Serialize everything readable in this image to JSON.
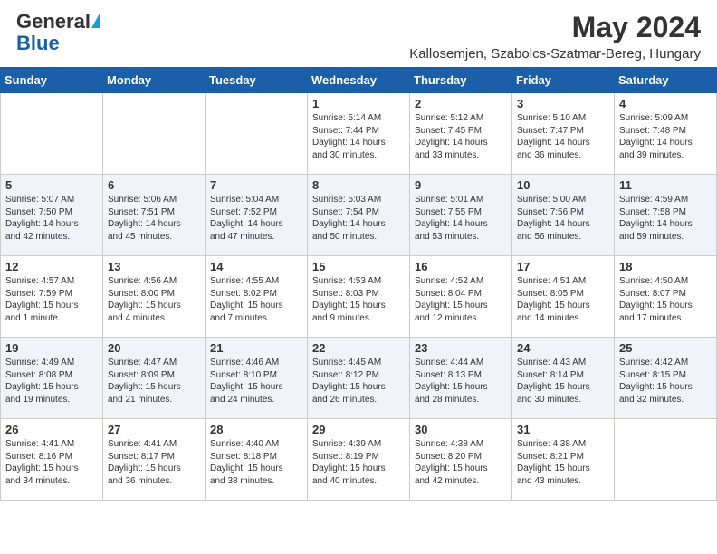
{
  "header": {
    "logo_general": "General",
    "logo_blue": "Blue",
    "month_title": "May 2024",
    "location": "Kallosemjen, Szabolcs-Szatmar-Bereg, Hungary"
  },
  "days_of_week": [
    "Sunday",
    "Monday",
    "Tuesday",
    "Wednesday",
    "Thursday",
    "Friday",
    "Saturday"
  ],
  "weeks": [
    [
      {
        "day": "",
        "lines": []
      },
      {
        "day": "",
        "lines": []
      },
      {
        "day": "",
        "lines": []
      },
      {
        "day": "1",
        "lines": [
          "Sunrise: 5:14 AM",
          "Sunset: 7:44 PM",
          "Daylight: 14 hours",
          "and 30 minutes."
        ]
      },
      {
        "day": "2",
        "lines": [
          "Sunrise: 5:12 AM",
          "Sunset: 7:45 PM",
          "Daylight: 14 hours",
          "and 33 minutes."
        ]
      },
      {
        "day": "3",
        "lines": [
          "Sunrise: 5:10 AM",
          "Sunset: 7:47 PM",
          "Daylight: 14 hours",
          "and 36 minutes."
        ]
      },
      {
        "day": "4",
        "lines": [
          "Sunrise: 5:09 AM",
          "Sunset: 7:48 PM",
          "Daylight: 14 hours",
          "and 39 minutes."
        ]
      }
    ],
    [
      {
        "day": "5",
        "lines": [
          "Sunrise: 5:07 AM",
          "Sunset: 7:50 PM",
          "Daylight: 14 hours",
          "and 42 minutes."
        ]
      },
      {
        "day": "6",
        "lines": [
          "Sunrise: 5:06 AM",
          "Sunset: 7:51 PM",
          "Daylight: 14 hours",
          "and 45 minutes."
        ]
      },
      {
        "day": "7",
        "lines": [
          "Sunrise: 5:04 AM",
          "Sunset: 7:52 PM",
          "Daylight: 14 hours",
          "and 47 minutes."
        ]
      },
      {
        "day": "8",
        "lines": [
          "Sunrise: 5:03 AM",
          "Sunset: 7:54 PM",
          "Daylight: 14 hours",
          "and 50 minutes."
        ]
      },
      {
        "day": "9",
        "lines": [
          "Sunrise: 5:01 AM",
          "Sunset: 7:55 PM",
          "Daylight: 14 hours",
          "and 53 minutes."
        ]
      },
      {
        "day": "10",
        "lines": [
          "Sunrise: 5:00 AM",
          "Sunset: 7:56 PM",
          "Daylight: 14 hours",
          "and 56 minutes."
        ]
      },
      {
        "day": "11",
        "lines": [
          "Sunrise: 4:59 AM",
          "Sunset: 7:58 PM",
          "Daylight: 14 hours",
          "and 59 minutes."
        ]
      }
    ],
    [
      {
        "day": "12",
        "lines": [
          "Sunrise: 4:57 AM",
          "Sunset: 7:59 PM",
          "Daylight: 15 hours",
          "and 1 minute."
        ]
      },
      {
        "day": "13",
        "lines": [
          "Sunrise: 4:56 AM",
          "Sunset: 8:00 PM",
          "Daylight: 15 hours",
          "and 4 minutes."
        ]
      },
      {
        "day": "14",
        "lines": [
          "Sunrise: 4:55 AM",
          "Sunset: 8:02 PM",
          "Daylight: 15 hours",
          "and 7 minutes."
        ]
      },
      {
        "day": "15",
        "lines": [
          "Sunrise: 4:53 AM",
          "Sunset: 8:03 PM",
          "Daylight: 15 hours",
          "and 9 minutes."
        ]
      },
      {
        "day": "16",
        "lines": [
          "Sunrise: 4:52 AM",
          "Sunset: 8:04 PM",
          "Daylight: 15 hours",
          "and 12 minutes."
        ]
      },
      {
        "day": "17",
        "lines": [
          "Sunrise: 4:51 AM",
          "Sunset: 8:05 PM",
          "Daylight: 15 hours",
          "and 14 minutes."
        ]
      },
      {
        "day": "18",
        "lines": [
          "Sunrise: 4:50 AM",
          "Sunset: 8:07 PM",
          "Daylight: 15 hours",
          "and 17 minutes."
        ]
      }
    ],
    [
      {
        "day": "19",
        "lines": [
          "Sunrise: 4:49 AM",
          "Sunset: 8:08 PM",
          "Daylight: 15 hours",
          "and 19 minutes."
        ]
      },
      {
        "day": "20",
        "lines": [
          "Sunrise: 4:47 AM",
          "Sunset: 8:09 PM",
          "Daylight: 15 hours",
          "and 21 minutes."
        ]
      },
      {
        "day": "21",
        "lines": [
          "Sunrise: 4:46 AM",
          "Sunset: 8:10 PM",
          "Daylight: 15 hours",
          "and 24 minutes."
        ]
      },
      {
        "day": "22",
        "lines": [
          "Sunrise: 4:45 AM",
          "Sunset: 8:12 PM",
          "Daylight: 15 hours",
          "and 26 minutes."
        ]
      },
      {
        "day": "23",
        "lines": [
          "Sunrise: 4:44 AM",
          "Sunset: 8:13 PM",
          "Daylight: 15 hours",
          "and 28 minutes."
        ]
      },
      {
        "day": "24",
        "lines": [
          "Sunrise: 4:43 AM",
          "Sunset: 8:14 PM",
          "Daylight: 15 hours",
          "and 30 minutes."
        ]
      },
      {
        "day": "25",
        "lines": [
          "Sunrise: 4:42 AM",
          "Sunset: 8:15 PM",
          "Daylight: 15 hours",
          "and 32 minutes."
        ]
      }
    ],
    [
      {
        "day": "26",
        "lines": [
          "Sunrise: 4:41 AM",
          "Sunset: 8:16 PM",
          "Daylight: 15 hours",
          "and 34 minutes."
        ]
      },
      {
        "day": "27",
        "lines": [
          "Sunrise: 4:41 AM",
          "Sunset: 8:17 PM",
          "Daylight: 15 hours",
          "and 36 minutes."
        ]
      },
      {
        "day": "28",
        "lines": [
          "Sunrise: 4:40 AM",
          "Sunset: 8:18 PM",
          "Daylight: 15 hours",
          "and 38 minutes."
        ]
      },
      {
        "day": "29",
        "lines": [
          "Sunrise: 4:39 AM",
          "Sunset: 8:19 PM",
          "Daylight: 15 hours",
          "and 40 minutes."
        ]
      },
      {
        "day": "30",
        "lines": [
          "Sunrise: 4:38 AM",
          "Sunset: 8:20 PM",
          "Daylight: 15 hours",
          "and 42 minutes."
        ]
      },
      {
        "day": "31",
        "lines": [
          "Sunrise: 4:38 AM",
          "Sunset: 8:21 PM",
          "Daylight: 15 hours",
          "and 43 minutes."
        ]
      },
      {
        "day": "",
        "lines": []
      }
    ]
  ]
}
